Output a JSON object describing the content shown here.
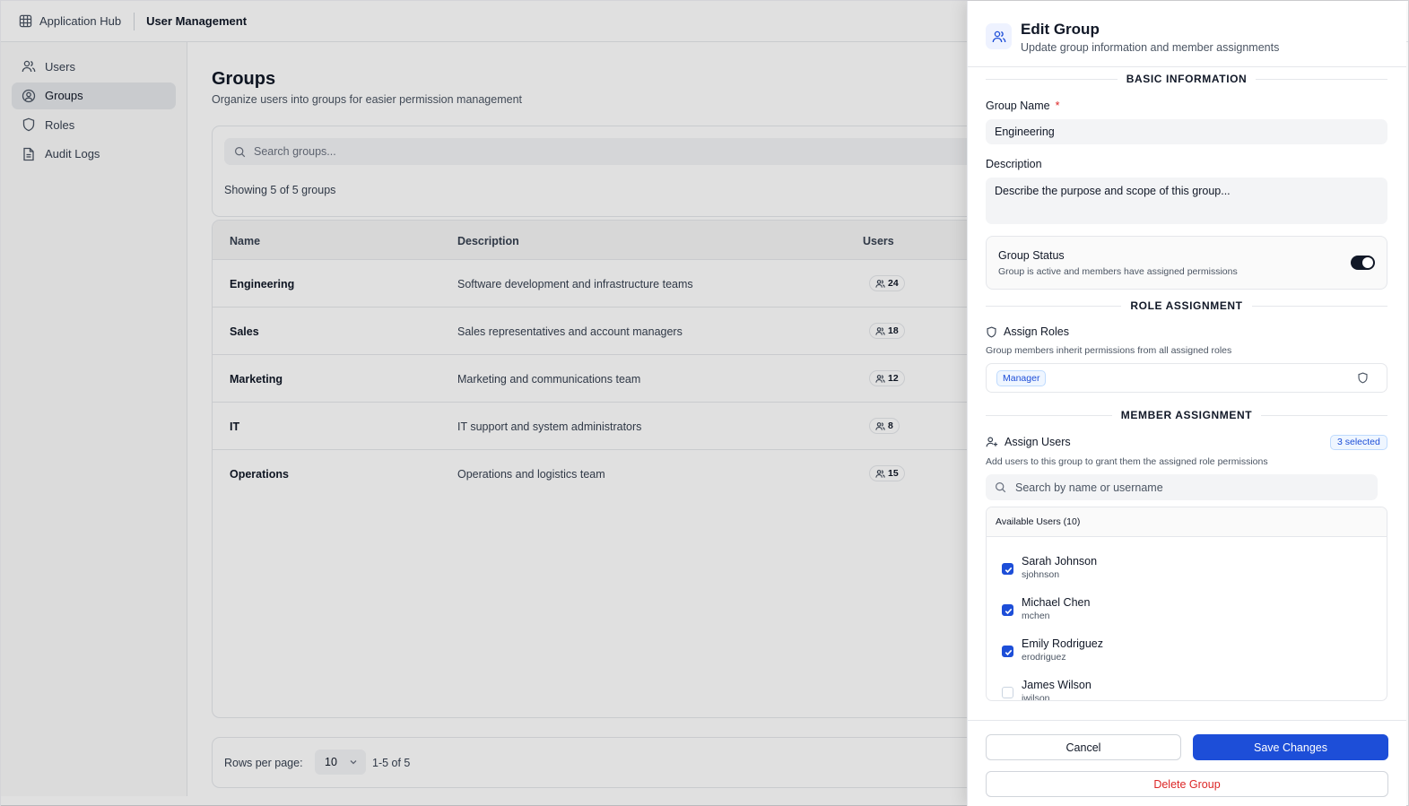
{
  "topbar": {
    "app_title": "Application Hub",
    "breadcrumb": "User Management"
  },
  "sidebar": {
    "items": [
      {
        "label": "Users",
        "icon": "users-icon"
      },
      {
        "label": "Groups",
        "icon": "groups-icon",
        "active": true
      },
      {
        "label": "Roles",
        "icon": "shield-icon"
      },
      {
        "label": "Audit Logs",
        "icon": "document-icon"
      }
    ]
  },
  "main": {
    "title": "Groups",
    "subtitle": "Organize users into groups for easier permission management",
    "search_placeholder": "Search groups...",
    "showing_text": "Showing 5 of 5 groups",
    "table": {
      "columns": [
        "Name",
        "Description",
        "Users"
      ],
      "rows": [
        {
          "name": "Engineering",
          "description": "Software development and infrastructure teams",
          "users": "24"
        },
        {
          "name": "Sales",
          "description": "Sales representatives and account managers",
          "users": "18"
        },
        {
          "name": "Marketing",
          "description": "Marketing and communications team",
          "users": "12"
        },
        {
          "name": "IT",
          "description": "IT support and system administrators",
          "users": "8"
        },
        {
          "name": "Operations",
          "description": "Operations and logistics team",
          "users": "15"
        }
      ]
    },
    "pagination": {
      "rows_per_page_label": "Rows per page:",
      "rows_per_page_value": "10",
      "range": "1-5 of 5"
    }
  },
  "drawer": {
    "title": "Edit Group",
    "subtitle": "Update group information and member assignments",
    "basic": {
      "section_title": "BASIC INFORMATION",
      "name_label": "Group Name",
      "required_mark": "*",
      "name_value": "Engineering",
      "description_label": "Description",
      "description_placeholder": "Describe the purpose and scope of this group...",
      "status_title": "Group Status",
      "status_desc": "Group is active and members have assigned permissions",
      "status_on": true
    },
    "roles": {
      "section_title": "ROLE ASSIGNMENT",
      "label": "Assign Roles",
      "helper": "Group members inherit permissions from all assigned roles",
      "selected": [
        "Manager"
      ]
    },
    "members": {
      "section_title": "MEMBER ASSIGNMENT",
      "label": "Assign Users",
      "selected_badge": "3 selected",
      "helper": "Add users to this group to grant them the assigned role permissions",
      "search_placeholder": "Search by name or username",
      "list_header": "Available Users (10)",
      "users": [
        {
          "name": "Sarah Johnson",
          "username": "sjohnson",
          "checked": true
        },
        {
          "name": "Michael Chen",
          "username": "mchen",
          "checked": true
        },
        {
          "name": "Emily Rodriguez",
          "username": "erodriguez",
          "checked": true
        },
        {
          "name": "James Wilson",
          "username": "jwilson",
          "checked": false
        }
      ]
    },
    "actions": {
      "cancel": "Cancel",
      "save": "Save Changes",
      "delete": "Delete Group"
    }
  },
  "colors": {
    "accent": "#1d4ed8",
    "danger": "#dc2626",
    "text": "#111827",
    "muted": "#4b5563"
  }
}
